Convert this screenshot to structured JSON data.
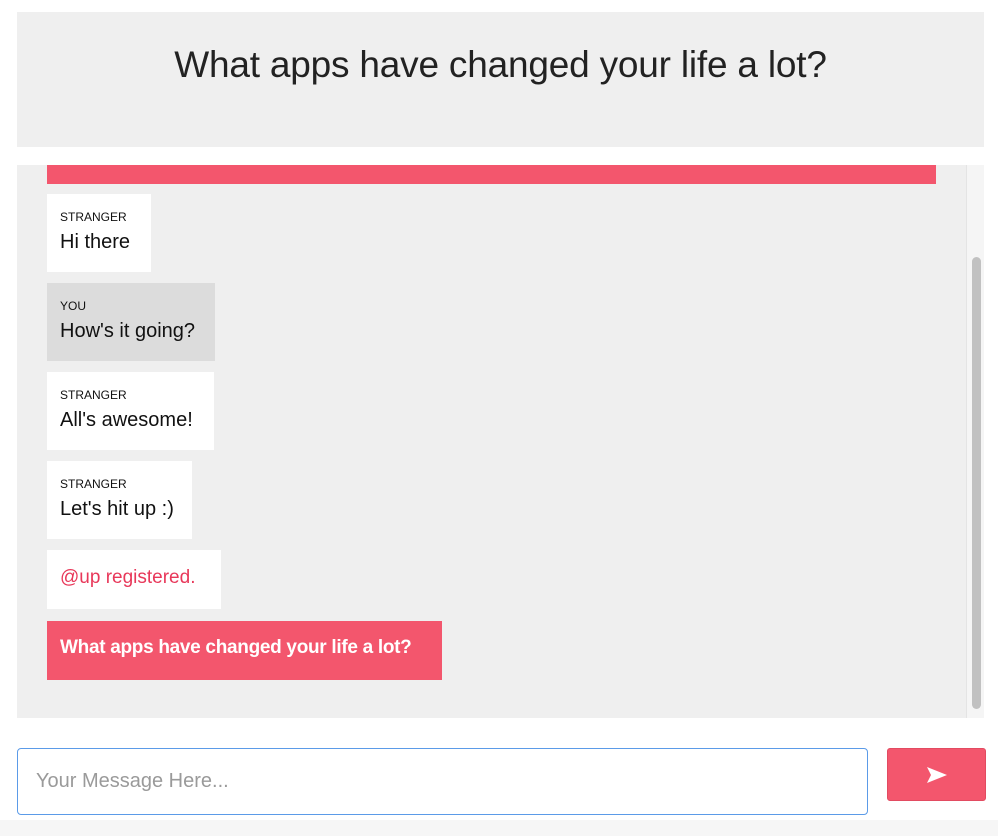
{
  "header": {
    "title": "What apps have changed your life a lot?"
  },
  "messages": [
    {
      "sender": "STRANGER",
      "text": "Hi there"
    },
    {
      "sender": "YOU",
      "text": "How's it going?"
    },
    {
      "sender": "STRANGER",
      "text": "All's awesome!"
    },
    {
      "sender": "STRANGER",
      "text": "Let's hit up :)"
    }
  ],
  "notice": {
    "text": "@up registered."
  },
  "question": {
    "text": "What apps have changed your life a lot?"
  },
  "composer": {
    "placeholder": "Your Message Here...",
    "send_icon": "send-arrow-icon"
  },
  "colors": {
    "accent": "#f3566d",
    "notice": "#e8385a",
    "panel": "#efefef",
    "you_bubble": "#dcdcdc"
  }
}
